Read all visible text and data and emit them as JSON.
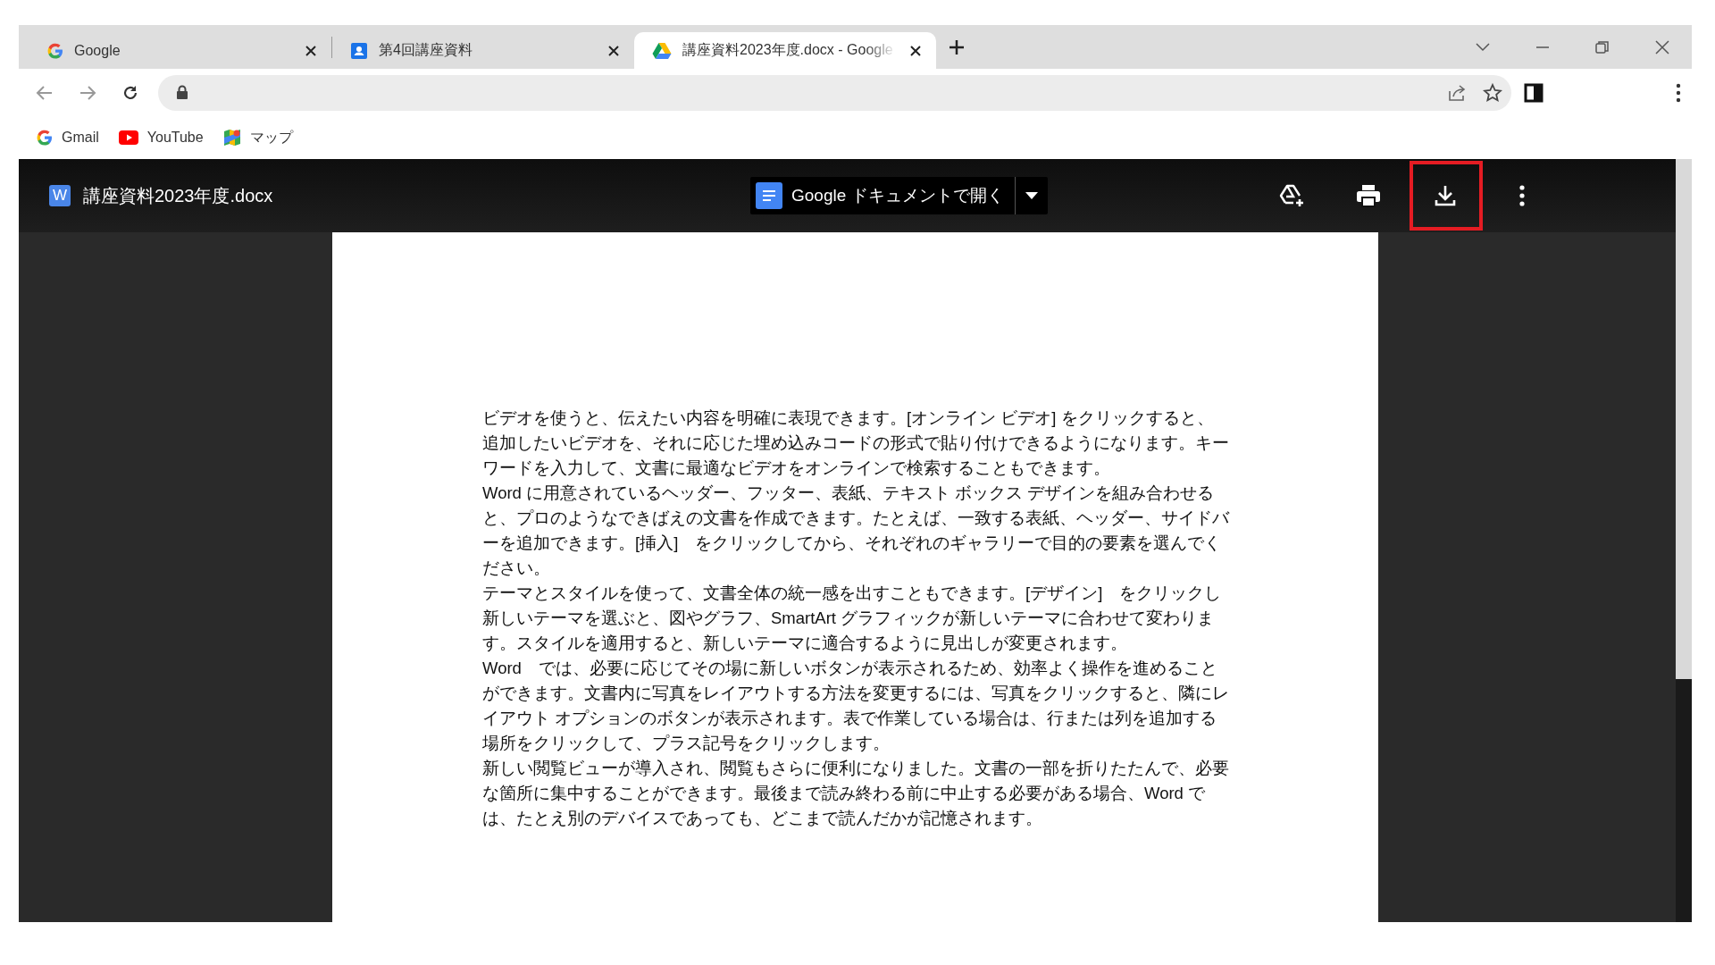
{
  "tabs": [
    {
      "kind": "google",
      "title": "Google",
      "selected": false
    },
    {
      "kind": "contacts",
      "title": "第4回講座資料",
      "selected": false
    },
    {
      "kind": "drive",
      "title": "講座資料2023年度.docx - Google",
      "selected": true
    }
  ],
  "bookmarks": [
    {
      "kind": "google",
      "label": "Gmail"
    },
    {
      "kind": "youtube",
      "label": "YouTube"
    },
    {
      "kind": "maps",
      "label": "マップ"
    }
  ],
  "viewer": {
    "file_name": "講座資料2023年度.docx",
    "file_badge": "W",
    "open_with": "Google ドキュメントで開く",
    "actions": [
      {
        "kind": "add-drive",
        "highlighted": false
      },
      {
        "kind": "print",
        "highlighted": false
      },
      {
        "kind": "download",
        "highlighted": true
      },
      {
        "kind": "more",
        "highlighted": false
      }
    ]
  },
  "document": {
    "paragraphs": [
      "ビデオを使うと、伝えたい内容を明確に表現できます。[オンライン ビデオ] をクリックすると、追加したいビデオを、それに応じた埋め込みコードの形式で貼り付けできるようになります。キーワードを入力して、文書に最適なビデオをオンラインで検索することもできます。",
      "Word に用意されているヘッダー、フッター、表紙、テキスト ボックス デザインを組み合わせると、プロのようなできばえの文書を作成できます。たとえば、一致する表紙、ヘッダー、サイドバーを追加できます。[挿入]　をクリックしてから、それぞれのギャラリーで目的の要素を選んでください。",
      "テーマとスタイルを使って、文書全体の統一感を出すこともできます。[デザイン]　をクリックし新しいテーマを選ぶと、図やグラフ、SmartArt グラフィックが新しいテーマに合わせて変わります。スタイルを適用すると、新しいテーマに適合するように見出しが変更されます。",
      "Word　では、必要に応じてその場に新しいボタンが表示されるため、効率よく操作を進めることができます。文書内に写真をレイアウトする方法を変更するには、写真をクリックすると、隣にレイアウト オプションのボタンが表示されます。表で作業している場合は、行または列を追加する場所をクリックして、プラス記号をクリックします。",
      "新しい閲覧ビューが導入され、閲覧もさらに便利になりました。文書の一部を折りたたんで、必要な箇所に集中することができます。最後まで読み終わる前に中止する必要がある場合、Word では、たとえ別のデバイスであっても、どこまで読んだかが記憶されます。"
    ]
  }
}
